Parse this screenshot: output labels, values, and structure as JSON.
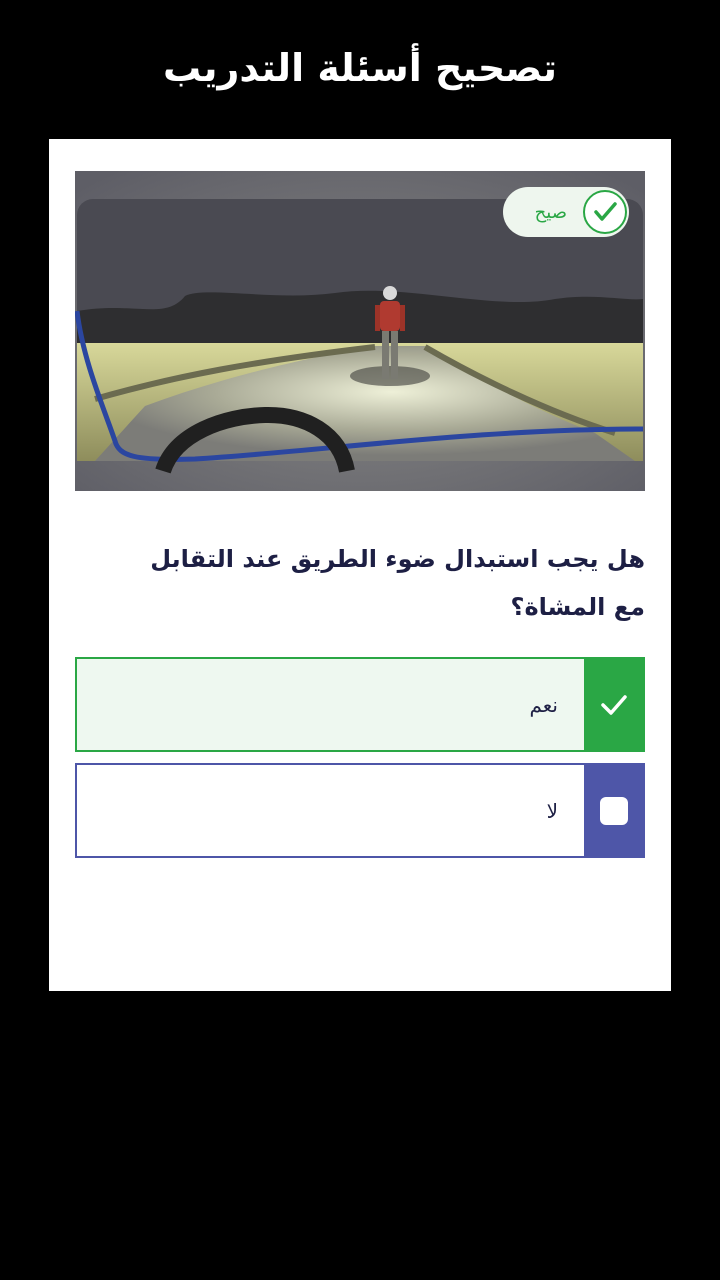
{
  "header": {
    "title": "تصحيح أسئلة التدريب"
  },
  "quiz": {
    "image": {
      "description_icon": "night-road-pedestrian-scene",
      "result_badge": {
        "label": "صيح",
        "icon": "check-circle-icon",
        "color": "#2aa745"
      }
    },
    "question": "هل يجب استبدال ضوء الطريق عند التقابل مع المشاة؟",
    "answers": [
      {
        "label": "نعم",
        "state": "correct-selected",
        "icon": "check-icon",
        "color": "#2aa745"
      },
      {
        "label": "لا",
        "state": "unselected",
        "icon": "empty-checkbox-icon",
        "color": "#4e56a8"
      }
    ]
  },
  "colors": {
    "background": "#000000",
    "card": "#ffffff",
    "correct": "#2aa745",
    "primary": "#4e56a8",
    "text": "#1d1f44"
  }
}
